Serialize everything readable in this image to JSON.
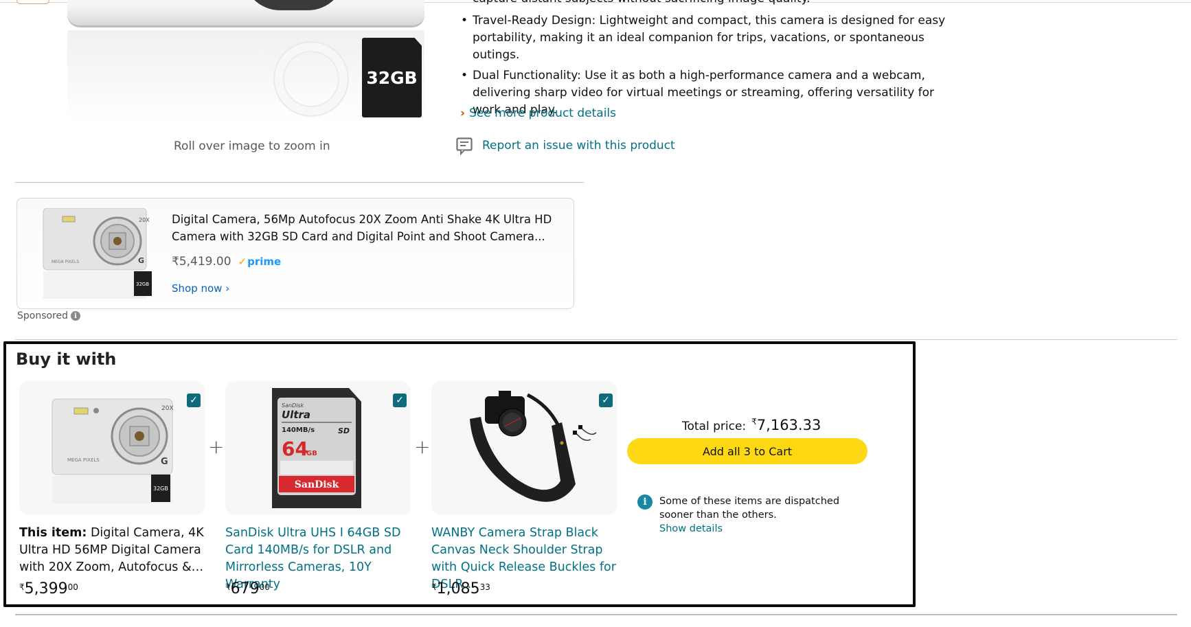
{
  "product_details": {
    "cut_off_line": "capture distant subjects without sacrificing image quality.",
    "bullets": [
      "Travel-Ready Design: Lightweight and compact, this camera is designed for easy portability, making it an ideal companion for trips, vacations, or spontaneous outings.",
      "Dual Functionality: Use it as both a high-performance camera and a webcam, delivering sharp video for virtual meetings or streaming, offering versatility for work and play."
    ],
    "see_more_label": "See more product details",
    "report_label": "Report an issue with this product"
  },
  "image_gallery": {
    "roll_over_hint": "Roll over image to zoom in",
    "sd_card_label": "32GB"
  },
  "sponsored_ad": {
    "title": "Digital Camera, 56Mp Autofocus 20X Zoom Anti Shake 4K Ultra HD Camera with 32GB SD Card and Digital Point and Shoot Camera...",
    "price": "₹5,419.00",
    "prime_label": "prime",
    "cta": "Shop now ›",
    "sponsored_label": "Sponsored",
    "sd_card_label": "32GB",
    "camera_text": "MEGA PIXELS",
    "camera_zoom": "20X"
  },
  "buy_it_with": {
    "title": "Buy it with",
    "items": [
      {
        "prefix": "This item:",
        "title": "Digital Camera, 4K Ultra HD 56MP Digital Camera with 20X Zoom, Autofocus &…",
        "price_symbol": "₹",
        "price_whole": "5,399",
        "price_fraction": "00",
        "checked": true,
        "sd_card_label": "32GB"
      },
      {
        "prefix": "",
        "title": "SanDisk Ultra UHS I 64GB SD Card 140MB/s for DSLR and Mirrorless Cameras, 10Y Warranty",
        "price_symbol": "₹",
        "price_whole": "679",
        "price_fraction": "00",
        "checked": true,
        "card_brand": "SanDisk",
        "card_line": "Ultra",
        "card_speed": "140MB/s",
        "card_capacity": "64",
        "card_unit": "GB"
      },
      {
        "prefix": "",
        "title": "WANBY Camera Strap Black Canvas Neck Shoulder Strap with Quick Release Buckles for DSLR…",
        "price_symbol": "₹",
        "price_whole": "1,085",
        "price_fraction": "33",
        "checked": true
      }
    ],
    "plus_sign": "+",
    "total_label": "Total price:",
    "total_symbol": "₹",
    "total_amount": "7,163.33",
    "add_to_cart_label": "Add all 3 to Cart",
    "dispatch_note": "Some of these items are dispatched sooner than the others.",
    "show_details_label": "Show details"
  },
  "colors": {
    "link": "#007185",
    "cta_yellow": "#FFD814",
    "checkbox": "#0F6A7C",
    "info_icon": "#1789A3",
    "see_more_chevron": "#C45500"
  }
}
